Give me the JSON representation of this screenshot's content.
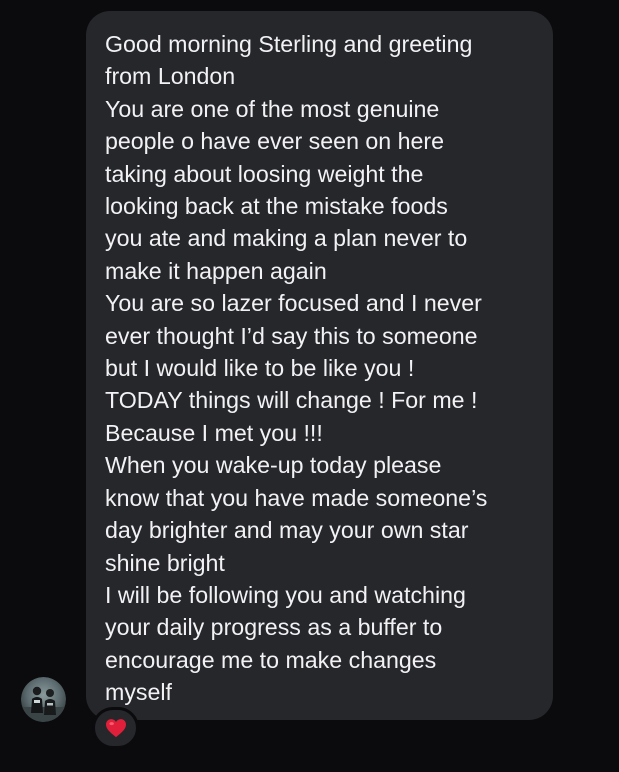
{
  "message": {
    "lines": [
      "Good morning Sterling and greeting",
      "from London",
      "You are one of the most genuine",
      "people o have ever seen on here",
      "taking about loosing weight the",
      "looking back at the mistake foods",
      "you ate and making a plan never to",
      "make it happen again",
      "You are so lazer focused and I never",
      "ever thought I’d say this to someone",
      "but I would like to be like you !",
      "TODAY things will change ! For me !",
      "Because I met you !!!",
      "When you wake-up today please",
      "know that you have made someone’s",
      "day brighter and may your own star",
      "shine bright",
      "I will be following you and watching",
      "your daily progress as a buffer to",
      "encourage me to make changes",
      "myself"
    ]
  },
  "sender": {
    "avatar_icon": "profile-photo-icon"
  },
  "reaction": {
    "icon": "red-heart-icon",
    "color": "#e0203a"
  },
  "colors": {
    "background": "#0b0b0d",
    "bubble": "#26272b",
    "text": "#f2f2f4"
  }
}
